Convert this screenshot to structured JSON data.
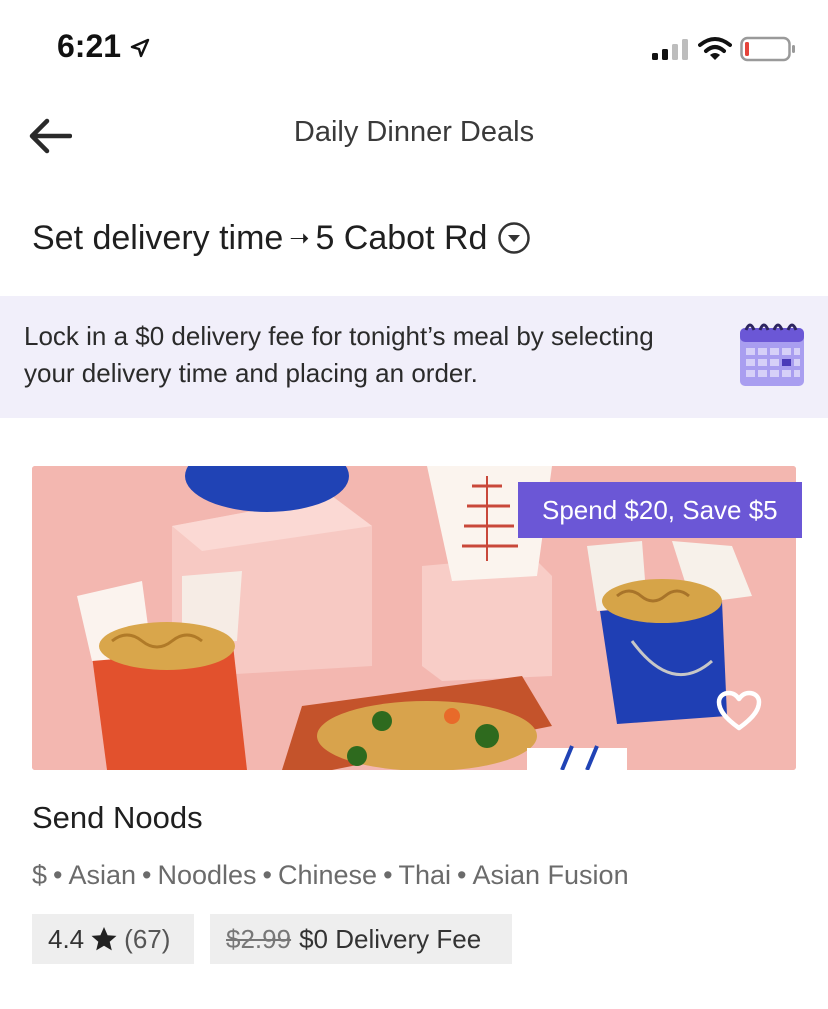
{
  "status_bar": {
    "time": "6:21"
  },
  "nav": {
    "title": "Daily Dinner Deals"
  },
  "delivery": {
    "schedule_label": "Set delivery time",
    "arrow": "➝",
    "address": "5 Cabot Rd"
  },
  "promo": {
    "text": "Lock in a $0 delivery fee for tonight’s meal by selecting your delivery time and placing an order."
  },
  "store": {
    "deal_badge": "Spend $20, Save $5",
    "name": "Send Noods",
    "tags": [
      "$",
      "Asian",
      "Noodles",
      "Chinese",
      "Thai",
      "Asian Fusion"
    ],
    "tag_separator": "•",
    "rating": "4.4",
    "rating_count": "(67)",
    "old_fee": "$2.99",
    "fee_label": "$0 Delivery Fee"
  },
  "colors": {
    "accent_purple": "#6b57d6",
    "banner_bg": "#f1effa",
    "hero_pink": "#f1b6b0"
  }
}
